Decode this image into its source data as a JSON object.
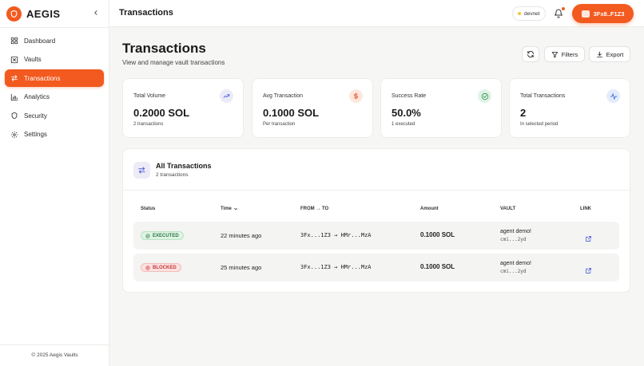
{
  "brand": {
    "name": "AEGIS"
  },
  "sidebar": {
    "items": [
      {
        "label": "Dashboard",
        "icon": "dashboard-icon",
        "active": false
      },
      {
        "label": "Vaults",
        "icon": "vault-icon",
        "active": false
      },
      {
        "label": "Transactions",
        "icon": "transfer-icon",
        "active": true
      },
      {
        "label": "Analytics",
        "icon": "bar-chart-icon",
        "active": false
      },
      {
        "label": "Security",
        "icon": "shield-icon",
        "active": false
      },
      {
        "label": "Settings",
        "icon": "gear-icon",
        "active": false
      }
    ],
    "footer": "© 2025 Aegis Vaults"
  },
  "topbar": {
    "title": "Transactions",
    "network": "devnet",
    "wallet": "3Fx8..F1Z3"
  },
  "page": {
    "title": "Transactions",
    "subtitle": "View and manage vault transactions",
    "filters_label": "Filters",
    "export_label": "Export"
  },
  "stats": [
    {
      "label": "Total Volume",
      "value": "0.2000 SOL",
      "sub": "2 transactions",
      "icon": "trending-up-icon",
      "color": "#5b6cd8",
      "bg": "#ecebf8"
    },
    {
      "label": "Avg Transaction",
      "value": "0.1000 SOL",
      "sub": "Per transaction",
      "icon": "dollar-icon",
      "color": "#e8643a",
      "bg": "#fde7df"
    },
    {
      "label": "Success Rate",
      "value": "50.0%",
      "sub": "1 executed",
      "icon": "check-circle-icon",
      "color": "#3a9a5b",
      "bg": "#e0f3e6"
    },
    {
      "label": "Total Transactions",
      "value": "2",
      "sub": "In selected period",
      "icon": "activity-icon",
      "color": "#3f73d9",
      "bg": "#e3ecfb"
    }
  ],
  "table": {
    "title": "All Transactions",
    "subtitle": "2 transactions",
    "columns": [
      "Status",
      "Time",
      "FROM → TO",
      "Amount",
      "VAULT",
      "LINK"
    ],
    "rows": [
      {
        "status": "EXECUTED",
        "status_type": "ok",
        "time": "22 minutes ago",
        "route": "3Fx...1Z3 → HMr...MzA",
        "amount": "0.1000 SOL",
        "vault_name": "agent demo!",
        "vault_id": "cmi...2yd"
      },
      {
        "status": "BLOCKED",
        "status_type": "bad",
        "time": "25 minutes ago",
        "route": "3Fx...1Z3 → HMr...MzA",
        "amount": "0.1000 SOL",
        "vault_name": "agent demo!",
        "vault_id": "cmi...2yd"
      }
    ]
  },
  "colors": {
    "accent": "#f25a1f",
    "success": "#2d7a44",
    "danger": "#c53a3a"
  }
}
